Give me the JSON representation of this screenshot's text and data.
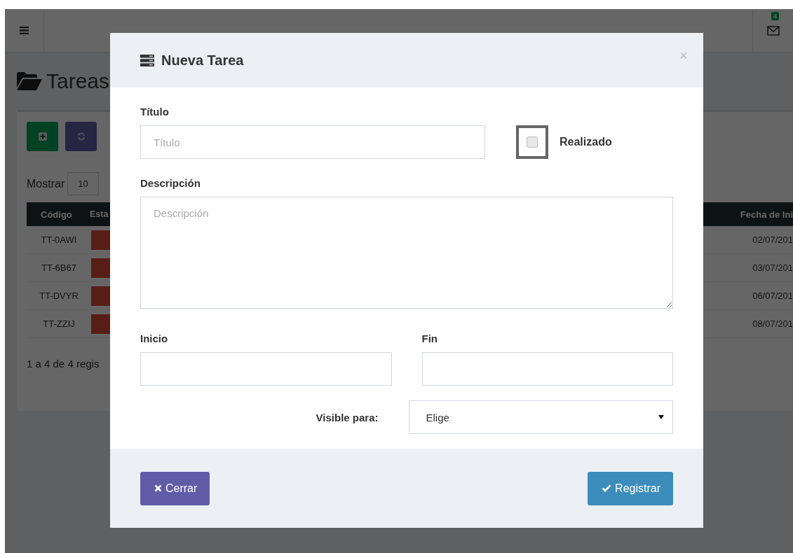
{
  "topbar": {
    "mail_count": "4"
  },
  "page": {
    "title": "Tareas",
    "length_label": "Mostrar",
    "length_value": "10",
    "info": "1 a 4 de 4 regis"
  },
  "table": {
    "columns": [
      "Código",
      "Esta",
      "Fecha de Ini"
    ],
    "rows": [
      {
        "code": "TT-0AWI",
        "date": "02/07/201"
      },
      {
        "code": "TT-6B67",
        "date": "03/07/201"
      },
      {
        "code": "TT-DVYR",
        "date": "06/07/201"
      },
      {
        "code": "TT-ZZIJ",
        "date": "08/07/201"
      }
    ]
  },
  "modal": {
    "title": "Nueva Tarea",
    "close": "×",
    "fields": {
      "title_label": "Título",
      "title_placeholder": "Título",
      "done_label": "Realizado",
      "done_checked": false,
      "description_label": "Descripción",
      "description_placeholder": "Descripción",
      "start_label": "Inicio",
      "end_label": "Fin",
      "visible_label": "Visible para:",
      "visible_value": "Elige"
    },
    "buttons": {
      "close": "Cerrar",
      "submit": "Registrar"
    }
  }
}
